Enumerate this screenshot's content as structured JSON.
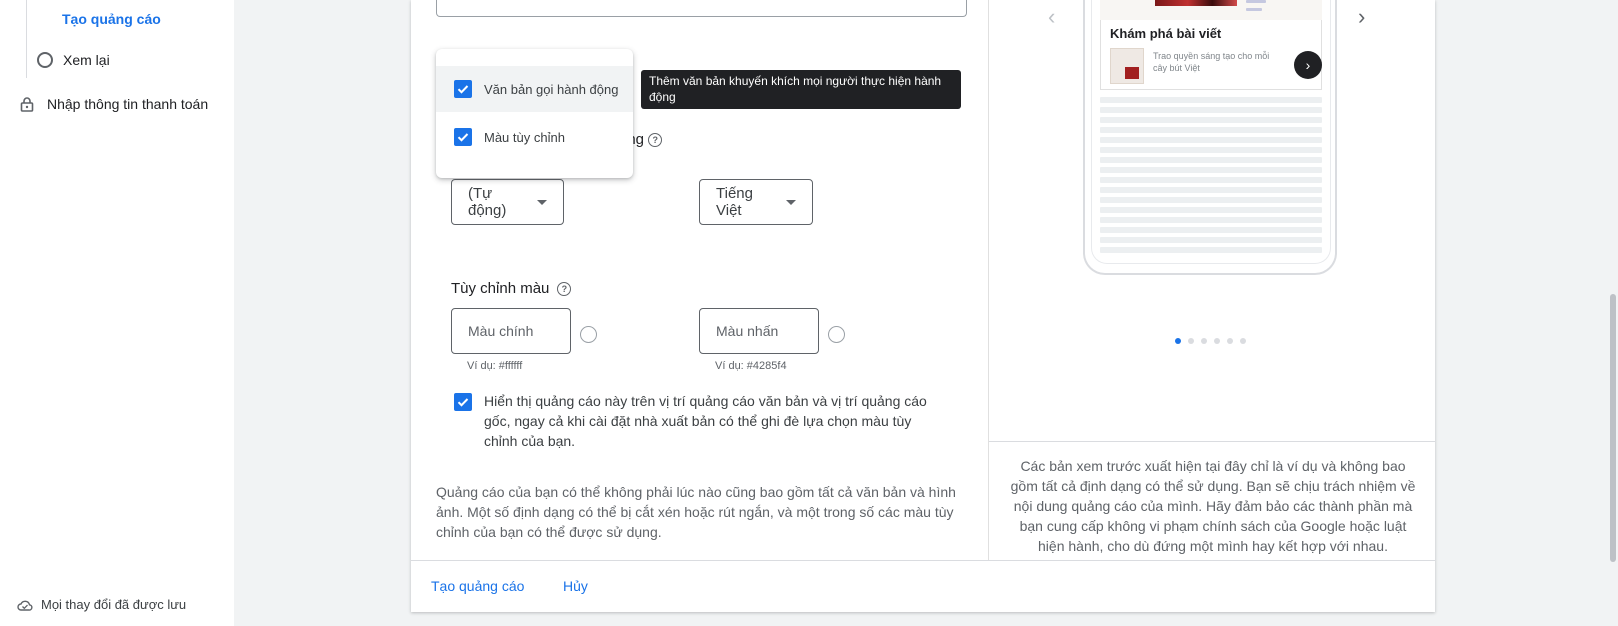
{
  "sidebar": {
    "active_item": "Tạo quảng cáo",
    "review_item": "Xem lại",
    "payment_item": "Nhập thông tin thanh toán",
    "saved_status": "Mọi thay đổi đã được lưu"
  },
  "form": {
    "cta_label_visible": "ộng",
    "cta_select_value": "(Tự động)",
    "language_select_value": "Tiếng Việt",
    "color_section_title": "Tùy chỉnh màu",
    "main_color_placeholder": "Màu chính",
    "main_color_hint": "Ví dụ: #ffffff",
    "accent_color_placeholder": "Màu nhấn",
    "accent_color_hint": "Ví dụ: #4285f4",
    "show_checkbox_label": "Hiển thị quảng cáo này trên vị trí quảng cáo văn bản và vị trí quảng cáo gốc, ngay cả khi cài đặt nhà xuất bản có thể ghi đè lựa chọn màu tùy chỉnh của bạn.",
    "note": "Quảng cáo của bạn có thể không phải lúc nào cũng bao gồm tất cả văn bản và hình ảnh. Một số định dạng có thể bị cắt xén hoặc rút ngắn, và một trong số các màu tùy chỉnh của bạn có thể được sử dụng."
  },
  "menu": {
    "items": [
      {
        "label": "Văn bản gọi hành động",
        "checked": true
      },
      {
        "label": "Màu tùy chỉnh",
        "checked": true
      }
    ],
    "tooltip": "Thêm văn bản khuyến khích mọi người thực hiện hành động"
  },
  "preview": {
    "ad_title": "Khám phá bài viết",
    "ad_subtitle": "Trao quyền sáng tạo cho mỗi cây bút Việt",
    "active_dot": 1,
    "dot_count": 6,
    "disclaimer": "Các bản xem trước xuất hiện tại đây chỉ là ví dụ và không bao gồm tất cả định dạng có thể sử dụng. Bạn sẽ chịu trách nhiệm về nội dung quảng cáo của mình. Hãy đảm bảo các thành phần mà bạn cung cấp không vi phạm chính sách của Google hoặc luật hiện hành, cho dù đứng một mình hay kết hợp với nhau."
  },
  "footer": {
    "create_label": "Tạo quảng cáo",
    "cancel_label": "Hủy"
  },
  "colors": {
    "accent": "#1a73e8",
    "checkbox": "#1a73e8",
    "tooltip_bg": "#202124"
  }
}
